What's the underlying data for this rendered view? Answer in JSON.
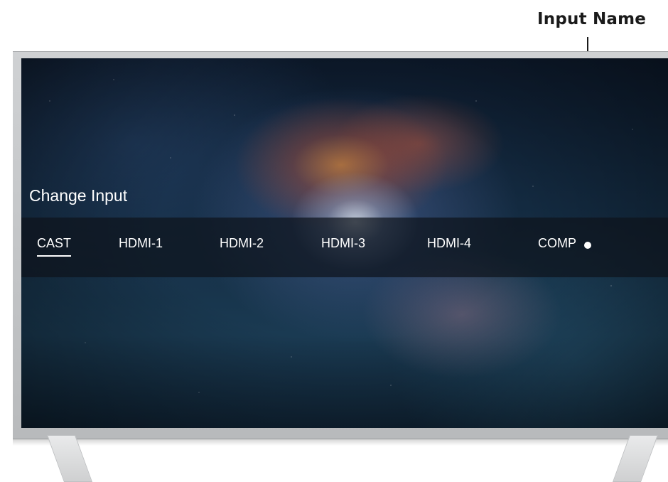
{
  "callout": {
    "label": "Input Name"
  },
  "menu": {
    "title": "Change Input",
    "inputs": [
      {
        "label": "CAST",
        "selected": true
      },
      {
        "label": "HDMI-1",
        "selected": false
      },
      {
        "label": "HDMI-2",
        "selected": false
      },
      {
        "label": "HDMI-3",
        "selected": false
      },
      {
        "label": "HDMI-4",
        "selected": false
      },
      {
        "label": "COMP",
        "selected": false
      }
    ]
  },
  "colors": {
    "callout_text": "#1a1a1a",
    "menu_text": "#ffffff",
    "tv_frame": "#c4c6c8",
    "menu_bar": "#0e141c"
  },
  "icons": {
    "callout_marker": "dot-icon"
  }
}
